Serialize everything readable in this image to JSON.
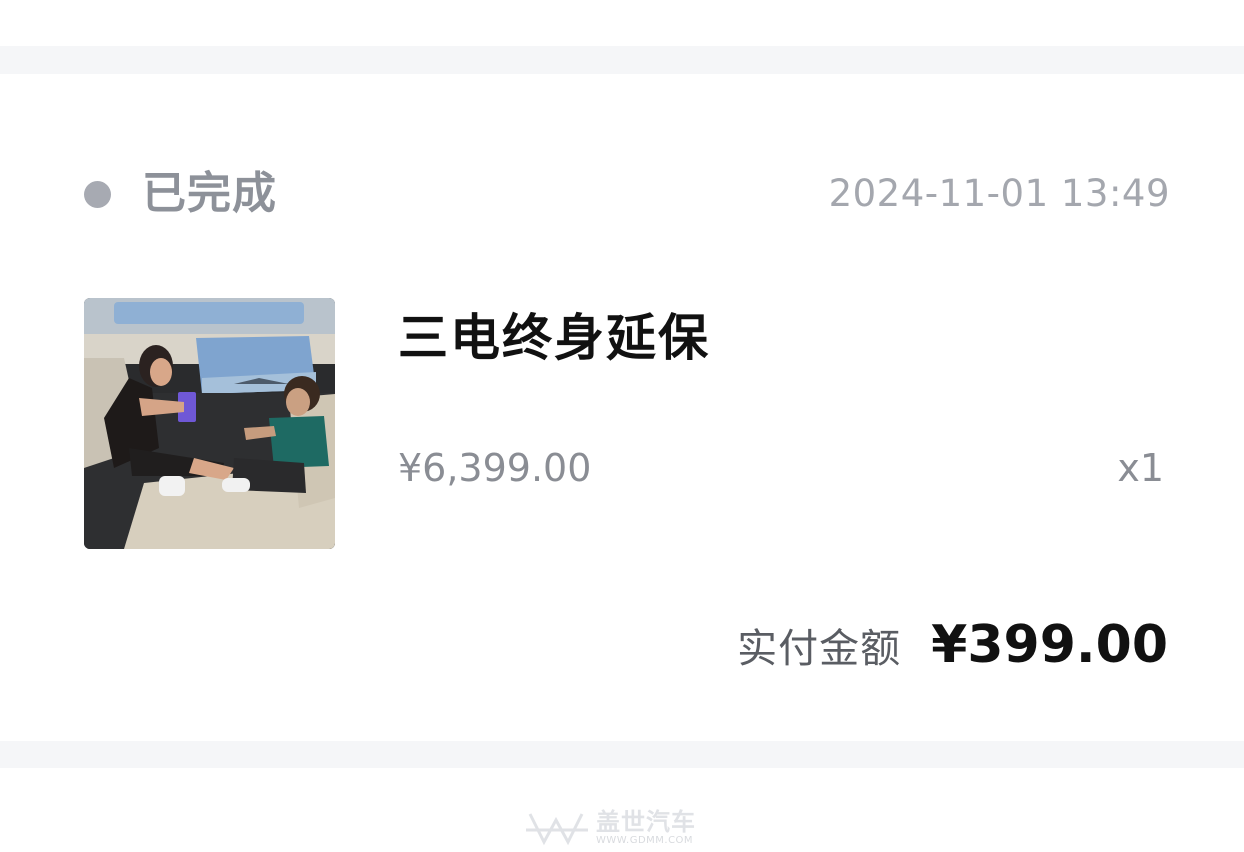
{
  "order": {
    "status": "已完成",
    "timestamp": "2024-11-01  13:49",
    "product": {
      "name": "三电终身延保",
      "unit_price": "¥6,399.00",
      "quantity": "x1",
      "image_alt": "车内后排乘客场景"
    },
    "payment": {
      "label": "实付金额",
      "amount": "¥399.00"
    }
  },
  "watermark": {
    "brand": "盖世汽车",
    "url": "WWW.GDMM.COM"
  },
  "colors": {
    "background": "#ffffff",
    "separator": "#f5f6f8",
    "status_dot": "#a7aab2",
    "muted_text": "#8d9199",
    "primary_text": "#111111"
  }
}
